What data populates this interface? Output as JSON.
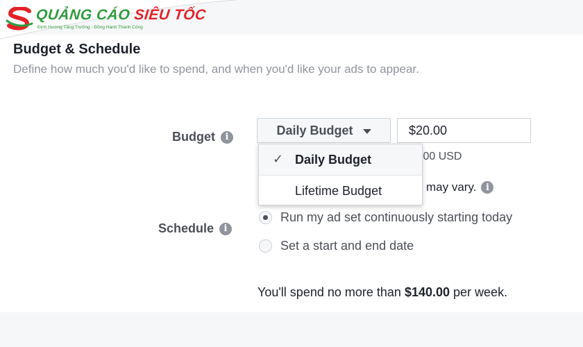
{
  "logo": {
    "brand_part1": "QUẢNG CÁO",
    "brand_part2": "SIÊU TỐC",
    "tagline": "Định Hướng Tăng Trưởng - Đồng Hành Thành Công",
    "colors": {
      "green": "#2e9b3c",
      "red": "#e32227"
    }
  },
  "section": {
    "title": "Budget & Schedule",
    "description": "Define how much you'd like to spend, and when you'd like your ads to appear."
  },
  "budget": {
    "label": "Budget",
    "info_icon": "info-icon",
    "selected_type": "Daily Budget",
    "amount": "$20.00",
    "hint_partial": ".00 USD",
    "hint_partial2": "may vary.",
    "menu": {
      "check_icon": "✓",
      "items": [
        {
          "label": "Daily Budget",
          "selected": true
        },
        {
          "label": "Lifetime Budget",
          "selected": false
        }
      ]
    }
  },
  "schedule": {
    "label": "Schedule",
    "options": [
      {
        "label": "Run my ad set continuously starting today",
        "selected": true
      },
      {
        "label": "Set a start and end date",
        "selected": false
      }
    ]
  },
  "summary": {
    "prefix": "You'll spend no more than",
    "amount": "$140.00",
    "suffix": "per week."
  }
}
